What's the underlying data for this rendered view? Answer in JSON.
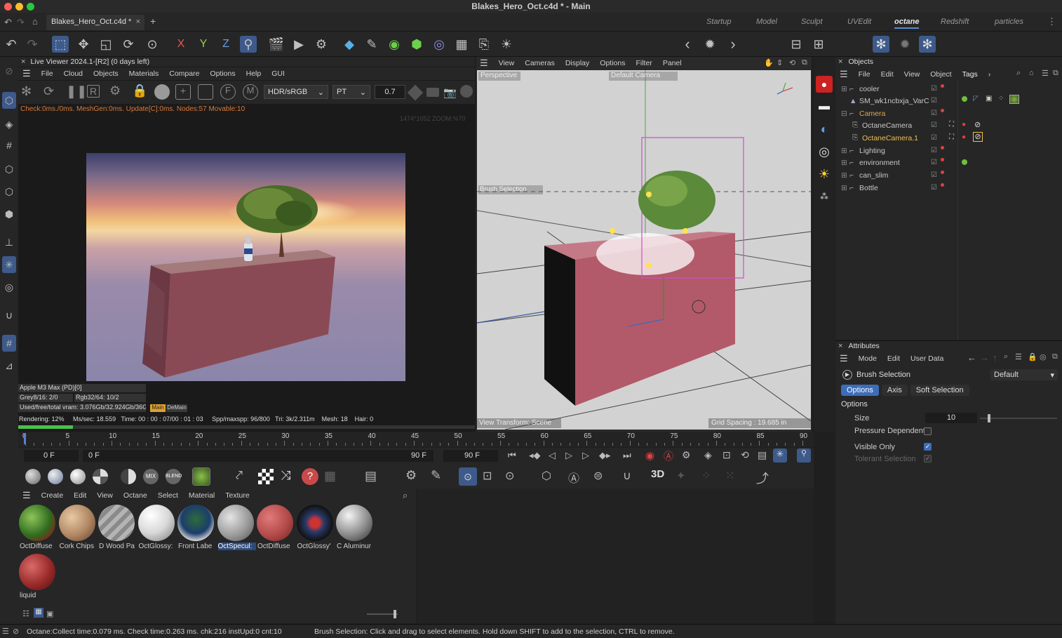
{
  "window_title": "Blakes_Hero_Oct.c4d * - Main",
  "document_tab": "Blakes_Hero_Oct.c4d *",
  "layouts": [
    "Startup",
    "Model",
    "Sculpt",
    "UVEdit",
    "octane",
    "Redshift",
    "particles"
  ],
  "live_viewer": {
    "title": "Live Viewer 2024.1-[R2] (0 days left)",
    "menu": [
      "File",
      "Cloud",
      "Objects",
      "Materials",
      "Compare",
      "Options",
      "Help",
      "GUI"
    ],
    "color_space": "HDR/sRGB",
    "kernel": "PT",
    "exposure": "0.7",
    "stats_line": "Check:0ms./0ms. MeshGen:0ms. Update[C]:0ms. Nodes:57 Movable:10",
    "resolution_hint": "1474*1052 ZOOM:%70",
    "gpu": "Apple M3 Max (PD)[0]",
    "grey": "Grey8/16: 2/0",
    "rgb": "Rgb32/64: 10/2",
    "vram": "Used/free/total vram: 3.076Gb/32.924Gb/36Gb",
    "btn_main": "Main",
    "btn_demain": "DeMain",
    "render_progress": 0.12,
    "render_stats": "Rendering: 12%     Ms/sec: 18.559   Time: 00 : 00 : 07/00 : 01 : 03     Spp/maxspp: 96/800   Tri: 3k/2.311m    Mesh: 18    Hair: 0"
  },
  "viewport": {
    "menu": [
      "View",
      "Cameras",
      "Display",
      "Options",
      "Filter",
      "Panel"
    ],
    "mode": "Perspective",
    "camera": "Default Camera",
    "brush_label": "Brush Selection",
    "view_transform": "View Transform: Scene",
    "grid_spacing": "Grid Spacing : 19.685 in"
  },
  "objects": {
    "title": "Objects",
    "menu": [
      "File",
      "Edit",
      "View",
      "Object",
      "Tags"
    ],
    "items": [
      {
        "name": "cooler",
        "indent": 0,
        "color": "#d0d0d0"
      },
      {
        "name": "SM_wk1ncbxja_VarC",
        "indent": 0,
        "color": "#d0d0d0"
      },
      {
        "name": "Camera",
        "indent": 0,
        "color": "#e3a64a"
      },
      {
        "name": "OctaneCamera",
        "indent": 1,
        "color": "#d0d0d0"
      },
      {
        "name": "OctaneCamera.1",
        "indent": 1,
        "color": "#f0c04a"
      },
      {
        "name": "Lighting",
        "indent": 0,
        "color": "#d0d0d0"
      },
      {
        "name": "environment",
        "indent": 0,
        "color": "#d0d0d0"
      },
      {
        "name": "can_slim",
        "indent": 0,
        "color": "#d0d0d0"
      },
      {
        "name": "Bottle",
        "indent": 0,
        "color": "#d0d0d0"
      }
    ]
  },
  "attributes": {
    "title": "Attributes",
    "menu": [
      "Mode",
      "Edit",
      "User Data"
    ],
    "tool": "Brush Selection",
    "preset": "Default",
    "tabs": [
      "Options",
      "Axis",
      "Soft Selection"
    ],
    "section": "Options",
    "size_label": "Size",
    "size_value": "10",
    "size_fraction": 0.1,
    "pressure_label": "Pressure Dependent",
    "visible_label": "Visible Only",
    "tolerant_label": "Tolerant Selection"
  },
  "timeline": {
    "ticks": [
      "0",
      "5",
      "10",
      "15",
      "20",
      "25",
      "30",
      "35",
      "40",
      "45",
      "50",
      "55",
      "60",
      "65",
      "70",
      "75",
      "80",
      "85",
      "90"
    ],
    "start": "0 F",
    "current": "0 F",
    "end1": "90 F",
    "end2": "90 F"
  },
  "materials": {
    "menu": [
      "Create",
      "Edit",
      "View",
      "Octane",
      "Select",
      "Material",
      "Texture"
    ],
    "items": [
      {
        "name": "OctDiffuse",
        "bg": "radial-gradient(circle at 35% 35%,#8fc45a,#2f6b1f 55%,#7a2a1a 80%)"
      },
      {
        "name": "Cork Chips",
        "bg": "radial-gradient(circle at 35% 35%,#e8c9a4,#b08562 55%,#5a3f2a)"
      },
      {
        "name": "D Wood Pa",
        "bg": "repeating-linear-gradient(135deg,#8a8a8a 0 6px,#b4b4b4 6px 12px)"
      },
      {
        "name": "OctGlossy:",
        "bg": "radial-gradient(circle at 35% 30%,#ffffff,#d8d8d8 50%,#7a7a7a)"
      },
      {
        "name": "Front Labe",
        "bg": "radial-gradient(circle at 50% 40%,#2e6b3a,#1b3d6b 50%,#cfcfcf 75%)"
      },
      {
        "name": "OctSpecul:",
        "bg": "radial-gradient(circle at 35% 35%,#e4e4e4,#9a9a9a 55%,#505050)"
      },
      {
        "name": "OctDiffuse",
        "bg": "radial-gradient(circle at 35% 35%,#e07a7a,#b34a4a 55%,#6a2222)"
      },
      {
        "name": "OctGlossy'",
        "bg": "radial-gradient(circle at 50% 50%,#c33 0 18%,#2a3a6a 35%,#111 70%)"
      },
      {
        "name": "C Aluminur",
        "bg": "radial-gradient(circle at 35% 30%,#f4f4f4,#8c8c8c 55%,#2a2a2a)"
      },
      {
        "name": "liquid",
        "bg": "radial-gradient(circle at 35% 35%,#d86a6a,#9a2a2a 55%,#4a0f0f)"
      }
    ]
  },
  "status": {
    "left": "Octane:Collect time:0.079 ms.  Check time:0.263 ms.  chk:216  instUpd:0  cnt:10",
    "right": "Brush Selection: Click and drag to select elements. Hold down SHIFT to add to the selection, CTRL to remove."
  }
}
